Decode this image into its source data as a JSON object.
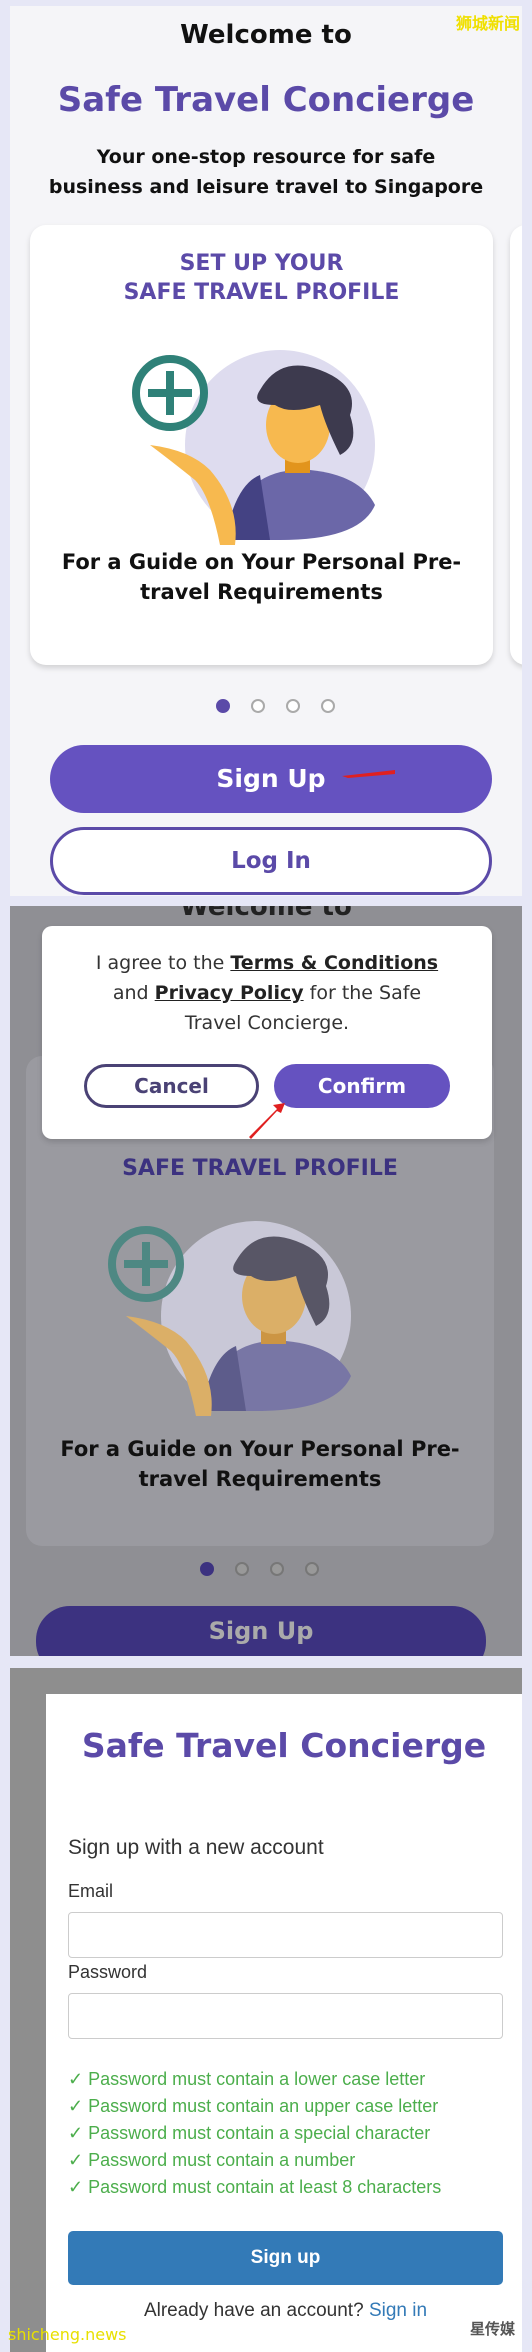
{
  "welcome": {
    "heading": "Welcome to",
    "title": "Safe Travel Concierge",
    "subtitle_line1": "Your one-stop resource for safe",
    "subtitle_line2": "business and leisure travel to Singapore",
    "card": {
      "title_line1": "SET UP YOUR",
      "title_line2": "SAFE TRAVEL PROFILE",
      "text_line1": "For a Guide on Your Personal Pre-",
      "text_line2": "travel Requirements"
    },
    "carousel": {
      "total": 4,
      "active": 1
    },
    "signup_label": "Sign Up",
    "login_label": "Log In"
  },
  "dialog": {
    "text_prefix": "I agree to the ",
    "terms": "Terms & Conditions",
    "text_and": " and",
    "privacy": "Privacy Policy",
    "text_suffix": " for the Safe Travel Concierge.",
    "cancel_label": "Cancel",
    "confirm_label": "Confirm",
    "behind_heading": "Welcome to",
    "behind_card_title": "SAFE TRAVEL PROFILE",
    "behind_text_line1": "For a Guide on Your Personal Pre-",
    "behind_text_line2": "travel Requirements",
    "behind_signup": "Sign Up"
  },
  "signup_form": {
    "title": "Safe Travel Concierge",
    "heading": "Sign up with a new account",
    "email_label": "Email",
    "email_value": "",
    "password_label": "Password",
    "password_value": "",
    "rules": [
      "✓ Password must contain a lower case letter",
      "✓ Password must contain an upper case letter",
      "✓ Password must contain a special character",
      "✓ Password must contain a number",
      "✓ Password must contain at least 8 characters"
    ],
    "submit_label": "Sign up",
    "already_text": "Already have an account? ",
    "signin_link": "Sign in"
  },
  "watermarks": {
    "top_right": "狮城新闻",
    "bottom_left": "shicheng.news",
    "bottom_right": "星传媒"
  },
  "colors": {
    "brand_purple": "#6552c0",
    "title_purple": "#5b4aa8",
    "rule_green": "#4cae4c",
    "submit_blue": "#337ab7",
    "annotation_arrow": "#e02020"
  }
}
